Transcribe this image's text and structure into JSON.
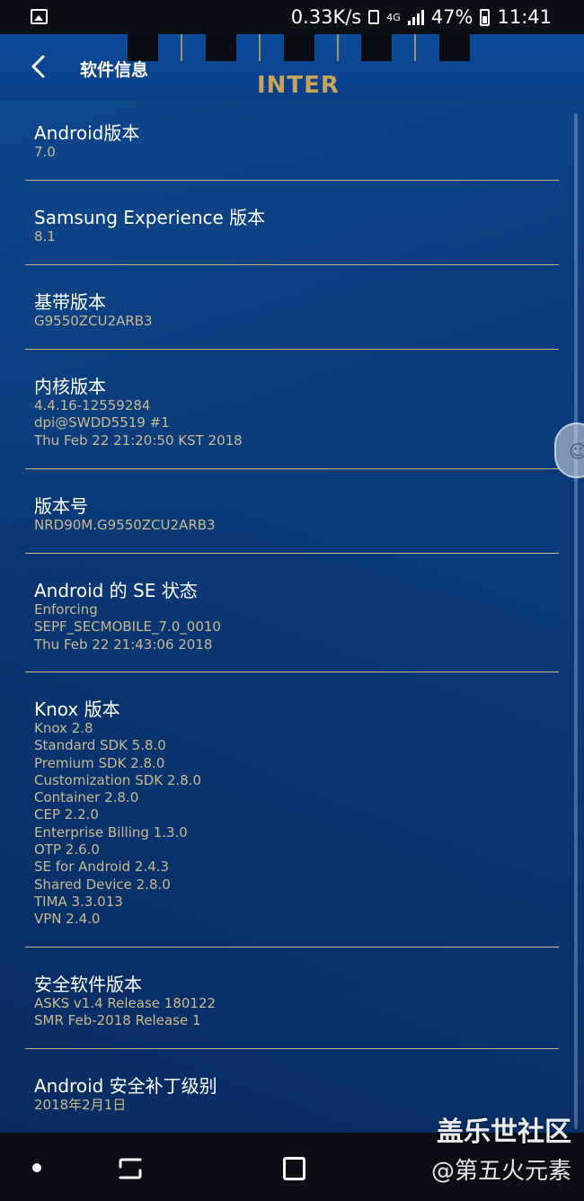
{
  "status_bar": {
    "speed": "0.33K/s",
    "network": "4G",
    "battery": "47%",
    "time": "11:41"
  },
  "header": {
    "title": "软件信息",
    "banner_text": "INTER"
  },
  "sections": [
    {
      "heading": "Android版本",
      "value": "7.0"
    },
    {
      "heading": "Samsung Experience 版本",
      "value": "8.1"
    },
    {
      "heading": "基带版本",
      "value": "G9550ZCU2ARB3"
    },
    {
      "heading": "内核版本",
      "value": "4.4.16-12559284\ndpi@SWDD5519 #1\nThu Feb 22 21:20:50 KST 2018"
    },
    {
      "heading": "版本号",
      "value": "NRD90M.G9550ZCU2ARB3"
    },
    {
      "heading": "Android 的 SE 状态",
      "value": "Enforcing\nSEPF_SECMOBILE_7.0_0010\nThu Feb 22 21:43:06 2018"
    },
    {
      "heading": "Knox 版本",
      "value": "Knox 2.8\nStandard SDK 5.8.0\nPremium SDK 2.8.0\nCustomization SDK 2.8.0\nContainer 2.8.0\nCEP 2.2.0\nEnterprise Billing 1.3.0\nOTP 2.6.0\nSE for Android 2.4.3\nShared Device 2.8.0\nTIMA 3.3.013\nVPN 2.4.0"
    },
    {
      "heading": "安全软件版本",
      "value": "ASKS v1.4 Release 180122\nSMR Feb-2018 Release 1"
    },
    {
      "heading": "Android 安全补丁级别",
      "value": "2018年2月1日"
    }
  ],
  "watermark": {
    "line1": "盖乐世社区",
    "line2": "@第五火元素"
  },
  "colors": {
    "background": "#0b3c7c",
    "heading_text": "#ffffff",
    "value_text": "#c9b98f",
    "divider": "#c7b58a",
    "status_bar": "#0a0f16"
  }
}
